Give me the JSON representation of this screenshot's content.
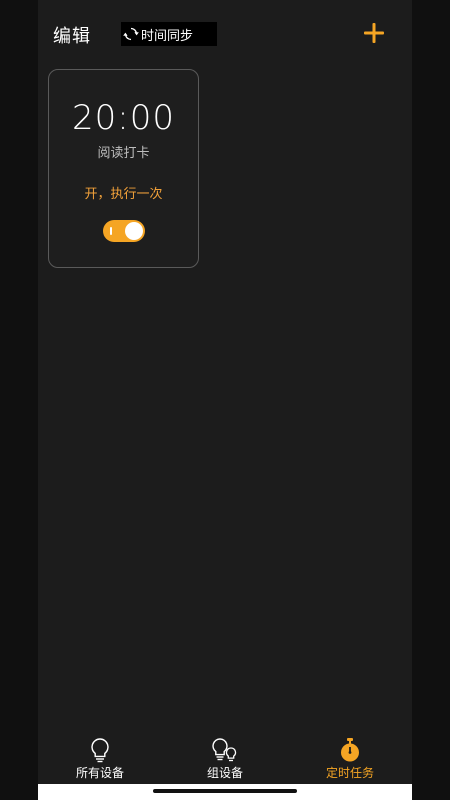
{
  "header": {
    "edit_label": "编辑",
    "sync_label": "时间同步",
    "sync_icon": "refresh-icon",
    "add_icon": "plus-icon"
  },
  "task_card": {
    "time": "20:00",
    "name": "阅读打卡",
    "action": "开，执行一次",
    "enabled": true
  },
  "tabbar": {
    "tabs": [
      {
        "label": "所有设备",
        "icon": "bulb-icon",
        "active": false
      },
      {
        "label": "组设备",
        "icon": "bulb-group-icon",
        "active": false
      },
      {
        "label": "定时任务",
        "icon": "stopwatch-icon",
        "active": true
      }
    ]
  },
  "colors": {
    "accent": "#f5a524",
    "background": "#1c1c1c",
    "card_border": "#5a5a5a"
  }
}
